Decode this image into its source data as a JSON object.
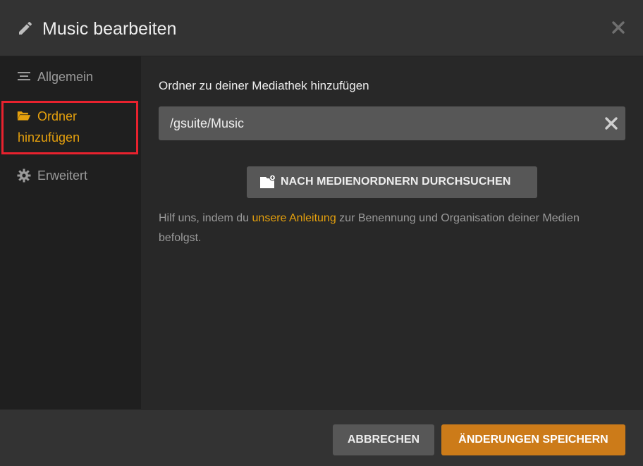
{
  "header": {
    "title": "Music bearbeiten",
    "edit_icon": "pencil-icon",
    "close_icon": "close-icon"
  },
  "sidebar": {
    "items": [
      {
        "label": "Allgemein",
        "icon": "list-icon",
        "active": false
      },
      {
        "label": "Ordner hinzufügen",
        "icon": "folder-open-icon",
        "active": true
      },
      {
        "label": "Erweitert",
        "icon": "gear-icon",
        "active": false
      }
    ]
  },
  "main": {
    "section_title": "Ordner zu deiner Mediathek hinzufügen",
    "folder_value": "/gsuite/Music",
    "browse_label": "NACH MEDIENORDNERN DURCHSUCHEN",
    "help": {
      "before": "Hilf uns, indem du ",
      "link": "unsere Anleitung",
      "after": " zur Benennung und Organisation deiner Medien befolgst."
    }
  },
  "footer": {
    "cancel_label": "ABBRECHEN",
    "save_label": "ÄNDERUNGEN SPEICHERN"
  },
  "colors": {
    "accent": "#e5a00d",
    "save_button": "#cc7b19",
    "highlight_box": "#e8222e"
  }
}
